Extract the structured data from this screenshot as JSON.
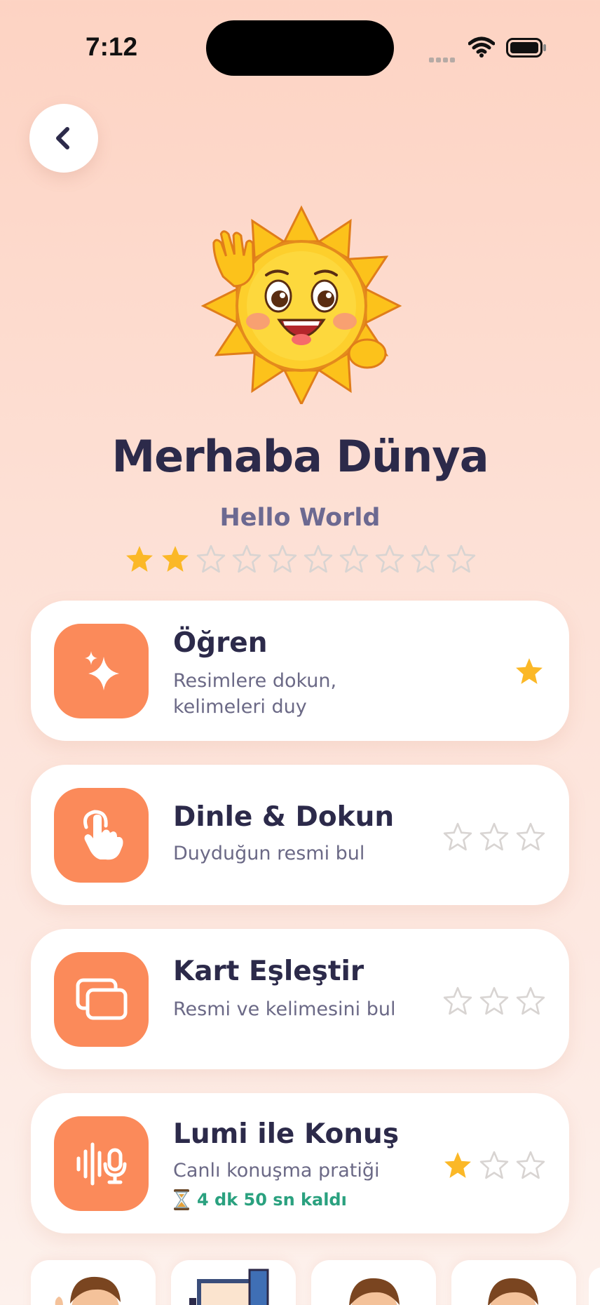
{
  "status_bar": {
    "time": "7:12"
  },
  "header": {
    "back_icon": "chevron-left-icon",
    "mascot": "waving-sun-mascot"
  },
  "lesson": {
    "title": "Merhaba Dünya",
    "subtitle": "Hello World",
    "stars_earned": 2,
    "stars_total": 10
  },
  "activities": [
    {
      "title": "Öğren",
      "description": "Resimlere dokun, kelimeleri duy",
      "icon": "sparkle-icon",
      "stars_earned": 1,
      "stars_total": 1
    },
    {
      "title": "Dinle & Dokun",
      "description": "Duyduğun resmi bul",
      "icon": "tap-hand-icon",
      "stars_earned": 0,
      "stars_total": 3
    },
    {
      "title": "Kart Eşleştir",
      "description": "Resmi ve kelimesini bul",
      "icon": "cards-icon",
      "stars_earned": 0,
      "stars_total": 3
    },
    {
      "title": "Lumi ile Konuş",
      "description": "Canlı konuşma pratiği",
      "icon": "voice-mic-icon",
      "timer_icon": "hourglass-icon",
      "timer": "4 dk 50 sn kaldı",
      "stars_earned": 1,
      "stars_total": 3
    }
  ],
  "colors": {
    "accent": "#fb8a5a",
    "star_filled": "#fbb827",
    "star_empty": "#d8d4d2",
    "title_text": "#2c2a4a",
    "timer_text": "#2aa17f"
  }
}
